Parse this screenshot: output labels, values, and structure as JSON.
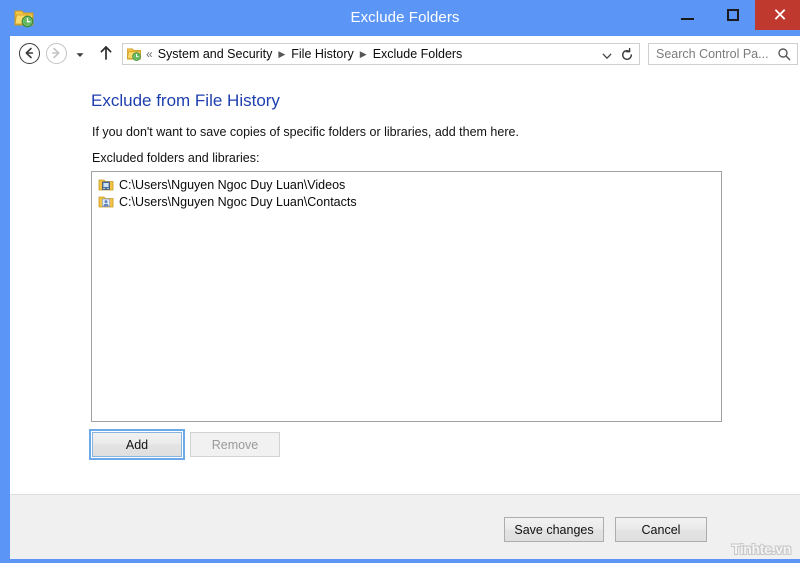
{
  "window": {
    "title": "Exclude Folders",
    "icon": "folder-history-icon",
    "frame_color": "#5b96f7",
    "controls": {
      "minimize": "minimize-icon",
      "maximize": "maximize-icon",
      "close": "close-icon",
      "close_color": "#c0392f"
    }
  },
  "nav": {
    "back": "back-arrow-icon",
    "forward": "forward-arrow-icon",
    "recent": "chevron-down-icon",
    "up": "up-arrow-icon",
    "address_icon": "folder-history-icon",
    "address_prefix": "«",
    "breadcrumbs": [
      "System and Security",
      "File History",
      "Exclude Folders"
    ],
    "breadcrumb_separator": "▸",
    "dropdown": "chevron-down-icon",
    "refresh": "refresh-icon"
  },
  "search": {
    "placeholder": "Search Control Pa...",
    "icon": "search-icon"
  },
  "main": {
    "heading": "Exclude from File History",
    "heading_color": "#1e3faf",
    "description": "If you don't want to save copies of specific folders or libraries, add them here.",
    "list_label": "Excluded folders and libraries:",
    "excluded": [
      {
        "path": "C:\\Users\\Nguyen Ngoc Duy Luan\\Videos",
        "icon": "folder-videos-icon"
      },
      {
        "path": "C:\\Users\\Nguyen Ngoc Duy Luan\\Contacts",
        "icon": "folder-contacts-icon"
      }
    ],
    "add_label": "Add",
    "remove_label": "Remove"
  },
  "footer": {
    "save_label": "Save changes",
    "cancel_label": "Cancel",
    "watermark": "Tinhte.vn"
  }
}
